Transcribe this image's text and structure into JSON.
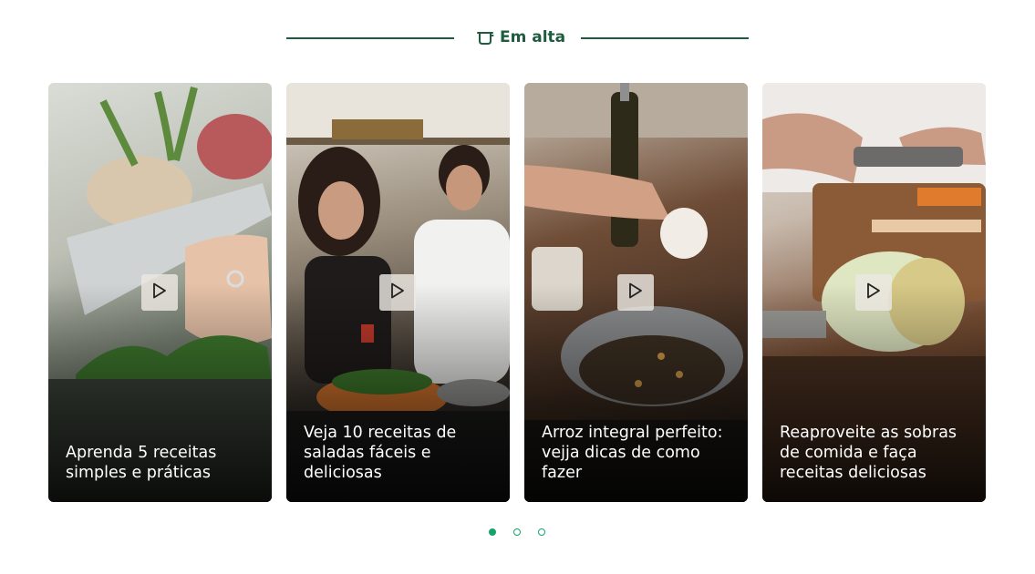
{
  "section": {
    "title": "Em alta",
    "icon": "cooking-pot-icon",
    "accent_color": "#1f5c3f"
  },
  "cards": [
    {
      "title": "Aprenda 5 receitas simples e práticas",
      "media": "video",
      "icon": "play-icon"
    },
    {
      "title": "Veja 10 receitas de saladas fáceis e deliciosas",
      "media": "video",
      "icon": "play-icon"
    },
    {
      "title": "Arroz integral perfeito: vejja dicas de como fazer",
      "media": "video",
      "icon": "play-icon"
    },
    {
      "title": "Reaproveite as sobras de comida e faça receitas deliciosas",
      "media": "video",
      "icon": "play-icon"
    }
  ],
  "pagination": {
    "pages": 3,
    "active": 1,
    "color": "#16a36a"
  }
}
